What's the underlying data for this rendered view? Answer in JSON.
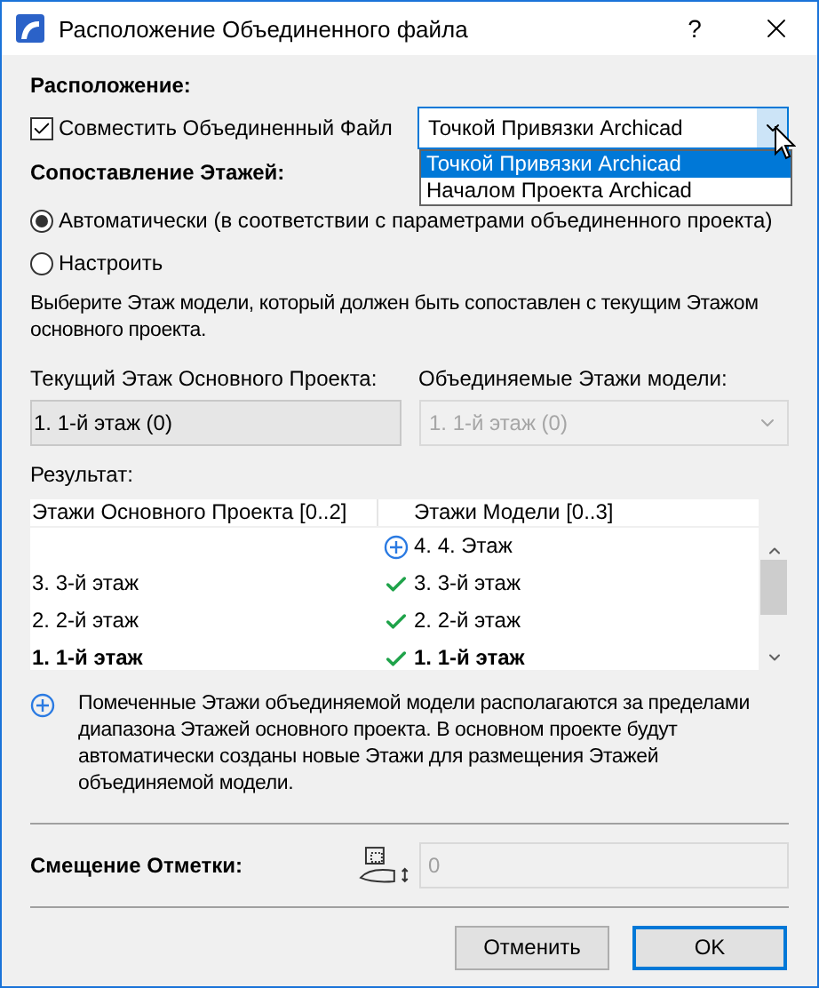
{
  "window": {
    "title": "Расположение Объединенного файла",
    "help": "?"
  },
  "placement": {
    "heading": "Расположение:",
    "checkbox": {
      "label": "Совместить Объединенный Файл",
      "checked": true
    },
    "dropdown": {
      "value": "Точкой Привязки Archicad",
      "expanded": true,
      "options": [
        {
          "label": "Точкой Привязки Archicad",
          "selected": true
        },
        {
          "label": "Началом Проекта Archicad",
          "selected": false
        }
      ]
    }
  },
  "story_matching": {
    "heading": "Сопоставление Этажей:",
    "options": [
      {
        "label": "Автоматически (в соответствии с параметрами объединенного проекта)",
        "selected": true
      },
      {
        "label": "Настроить",
        "selected": false
      }
    ],
    "description": "Выберите Этаж модели, который должен быть сопоставлен с текущим Этажом основного проекта.",
    "current_label": "Текущий Этаж Основного Проекта:",
    "current_value": "1. 1-й этаж (0)",
    "model_label": "Объединяемые Этажи модели:",
    "model_value": "1. 1-й этаж (0)",
    "model_disabled": true
  },
  "result": {
    "heading": "Результат:",
    "columns": [
      "Этажи Основного Проекта [0..2]",
      "Этажи Модели [0..3]"
    ],
    "rows": [
      {
        "host": "",
        "kind": "added",
        "model": "4. 4. Этаж",
        "current": false
      },
      {
        "host": "3. 3-й этаж",
        "kind": "matched",
        "model": "3. 3-й этаж",
        "current": false
      },
      {
        "host": "2. 2-й этаж",
        "kind": "matched",
        "model": "2. 2-й этаж",
        "current": false
      },
      {
        "host": "1. 1-й этаж",
        "kind": "matched",
        "model": "1. 1-й этаж",
        "current": true
      }
    ]
  },
  "note": "Помеченные Этажи объединяемой модели располагаются за пределами диапазона Этажей основного проекта. В основном проекте будут автоматически созданы новые Этажи для размещения Этажей объединяемой модели.",
  "elevation": {
    "label": "Смещение Отметки:",
    "value": "0"
  },
  "buttons": [
    {
      "label": "Отменить",
      "default": false
    },
    {
      "label": "OK",
      "default": true
    }
  ]
}
